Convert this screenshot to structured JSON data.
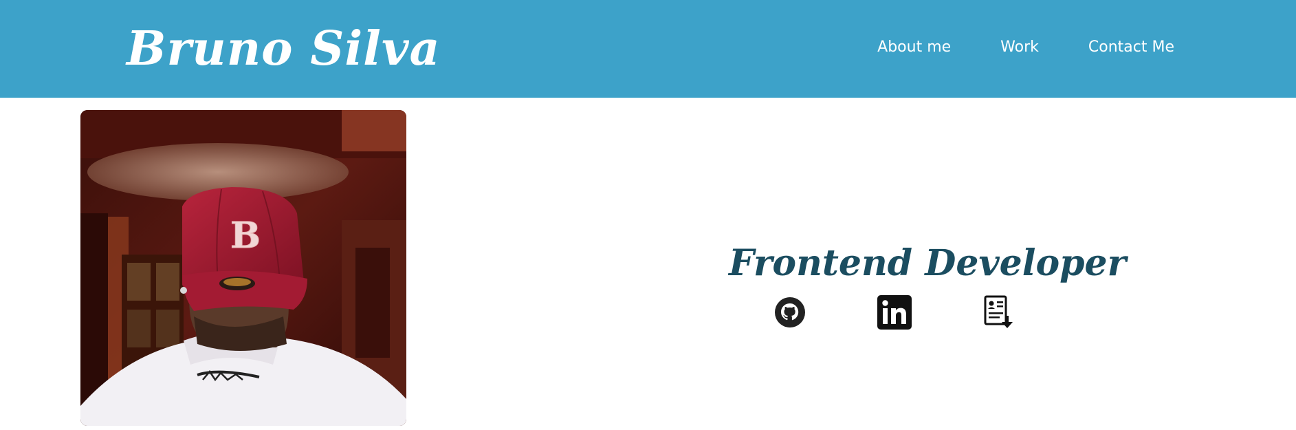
{
  "header": {
    "logo_text": "Bruno Silva",
    "background_color": "#3da2c9",
    "nav": [
      {
        "label": "About me"
      },
      {
        "label": "Work"
      },
      {
        "label": "Contact Me"
      }
    ]
  },
  "hero": {
    "photo_icon": "profile-photo",
    "role_title": "Frontend Developer",
    "role_title_color": "#1b4d60",
    "socials": [
      {
        "icon": "github-icon"
      },
      {
        "icon": "linkedin-icon"
      },
      {
        "icon": "resume-download-icon"
      }
    ]
  }
}
